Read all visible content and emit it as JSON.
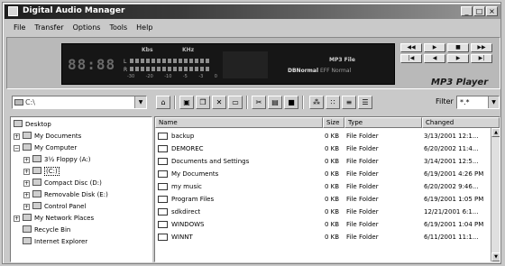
{
  "window": {
    "title": "Digital Audio Manager",
    "controls": [
      "_",
      "□",
      "×"
    ]
  },
  "menu": [
    "File",
    "Transfer",
    "Options",
    "Tools",
    "Help"
  ],
  "device": {
    "clock": "88:88",
    "kbps": "Kbs",
    "khz": "KHz",
    "channel_l": "L",
    "channel_r": "R",
    "scale": [
      "-30",
      "-20",
      "-10",
      "-5",
      "-3",
      "0"
    ],
    "file_label": "MP3 File",
    "status_prefix": "DBNormal",
    "status_value": "EFF Normal",
    "buttons": [
      "◀◀",
      "▶",
      "■",
      "▶▶",
      "|◀",
      "◀",
      "▶",
      "▶|"
    ],
    "brand": "MP3 Player"
  },
  "toolbar": {
    "drive_value": "C:\\",
    "filter_label": "Filter",
    "filter_value": "*.*"
  },
  "tree": [
    {
      "label": "Desktop",
      "indent": 0,
      "expander": ""
    },
    {
      "label": "My Documents",
      "indent": 1,
      "expander": "+"
    },
    {
      "label": "My Computer",
      "indent": 1,
      "expander": "−"
    },
    {
      "label": "3½ Floppy (A:)",
      "indent": 2,
      "expander": "+"
    },
    {
      "label": "(C:)",
      "indent": 2,
      "expander": "+",
      "selected": true
    },
    {
      "label": "Compact Disc (D:)",
      "indent": 2,
      "expander": "+"
    },
    {
      "label": "Removable Disk (E:)",
      "indent": 2,
      "expander": "+"
    },
    {
      "label": "Control Panel",
      "indent": 2,
      "expander": "+"
    },
    {
      "label": "My Network Places",
      "indent": 1,
      "expander": "+"
    },
    {
      "label": "Recycle Bin",
      "indent": 1,
      "expander": ""
    },
    {
      "label": "Internet Explorer",
      "indent": 1,
      "expander": ""
    }
  ],
  "list": {
    "columns": [
      "Name",
      "Size",
      "Type",
      "Changed"
    ],
    "rows": [
      {
        "name": "backup",
        "size": "0 KB",
        "type": "File Folder",
        "changed": "3/13/2001 12:1..."
      },
      {
        "name": "DEMOREC",
        "size": "0 KB",
        "type": "File Folder",
        "changed": "6/20/2002 11:4..."
      },
      {
        "name": "Documents and Settings",
        "size": "0 KB",
        "type": "File Folder",
        "changed": "3/14/2001 12:5..."
      },
      {
        "name": "My Documents",
        "size": "0 KB",
        "type": "File Folder",
        "changed": "6/19/2001 4:26 PM"
      },
      {
        "name": "my music",
        "size": "0 KB",
        "type": "File Folder",
        "changed": "6/20/2002 9:46..."
      },
      {
        "name": "Program Files",
        "size": "0 KB",
        "type": "File Folder",
        "changed": "6/19/2001 1:05 PM"
      },
      {
        "name": "sdkdirect",
        "size": "0 KB",
        "type": "File Folder",
        "changed": "12/21/2001 6:1..."
      },
      {
        "name": "WINDOWS",
        "size": "0 KB",
        "type": "File Folder",
        "changed": "6/19/2001 1:04 PM"
      },
      {
        "name": "WINNT",
        "size": "0 KB",
        "type": "File Folder",
        "changed": "6/11/2001 11:1..."
      }
    ]
  }
}
